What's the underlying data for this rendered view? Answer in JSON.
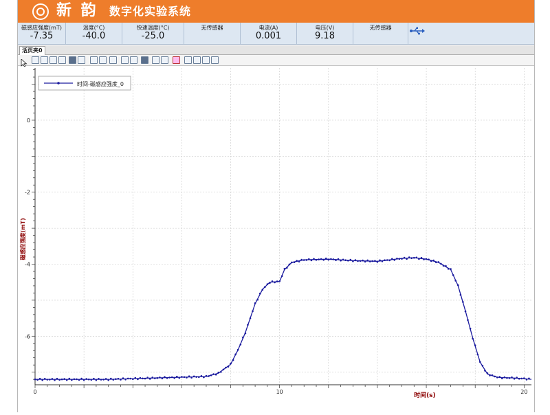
{
  "header": {
    "brand": "新 韵",
    "title": "数字化实验系统"
  },
  "sensors": [
    {
      "label": "磁感应强度(mT)",
      "value": "-7.35"
    },
    {
      "label": "温度(°C)",
      "value": "-40.0"
    },
    {
      "label": "快速温度(°C)",
      "value": "-25.0"
    },
    {
      "label": "无传感器",
      "value": ""
    },
    {
      "label": "电流(A)",
      "value": "0.001"
    },
    {
      "label": "电压(V)",
      "value": "9.18"
    },
    {
      "label": "无传感器",
      "value": ""
    }
  ],
  "icons": {
    "usb": "usb-icon",
    "logo": "logo-icon"
  },
  "tab": {
    "label": "活页夹0"
  },
  "toolbar": {
    "buttons": [
      "pointer-icon",
      "fit-icon",
      "zoom-in-icon",
      "zoom-out-icon",
      "zoom-icon",
      "table-icon",
      "grid-icon",
      "hand-icon",
      "range-icon",
      "marker-icon",
      "layout-icon",
      "export-icon",
      "save-icon",
      "curve-fit-icon",
      "tangent-icon",
      "chart-settings-icon",
      "edit-series-icon",
      "edit-axis-icon",
      "color-icon",
      "image-icon"
    ]
  },
  "colors": {
    "accent": "#ee7d2b",
    "series": "#1a1a9e",
    "axisLabel": "#8b0000"
  },
  "chart_data": {
    "type": "line",
    "xlabel": "时间(s)",
    "ylabel": "磁感应强度(mT)",
    "legend": {
      "label": "时间-磁感应强度_0",
      "position": "top-left"
    },
    "xlim": [
      0,
      20.3
    ],
    "ylim": [
      -7.35,
      1.45
    ],
    "xticks": [
      0,
      10,
      20
    ],
    "xtick_labels": [
      "0",
      "10",
      "20"
    ],
    "yticks": [
      0,
      -2,
      -4,
      -6
    ],
    "ytick_labels": [
      "0",
      "-2",
      "-4",
      "-6"
    ],
    "grid": true,
    "series": [
      {
        "name": "时间-磁感应强度_0",
        "x": [
          0,
          1,
          2,
          3,
          4,
          5,
          6,
          7,
          7.5,
          8,
          8.3,
          8.6,
          9,
          9.3,
          9.6,
          10,
          10.2,
          10.5,
          11,
          12,
          13,
          14,
          15,
          15.5,
          16,
          16.5,
          17,
          17.3,
          17.6,
          17.9,
          18.2,
          18.5,
          18.8,
          19,
          19.5,
          20,
          20.3
        ],
        "values": [
          -7.2,
          -7.2,
          -7.2,
          -7.2,
          -7.18,
          -7.16,
          -7.14,
          -7.12,
          -7.03,
          -6.78,
          -6.38,
          -5.9,
          -5.1,
          -4.7,
          -4.5,
          -4.48,
          -4.15,
          -3.95,
          -3.88,
          -3.86,
          -3.9,
          -3.92,
          -3.84,
          -3.82,
          -3.86,
          -3.95,
          -4.15,
          -4.6,
          -5.3,
          -6.05,
          -6.72,
          -7.05,
          -7.12,
          -7.15,
          -7.16,
          -7.18,
          -7.2
        ]
      }
    ]
  }
}
